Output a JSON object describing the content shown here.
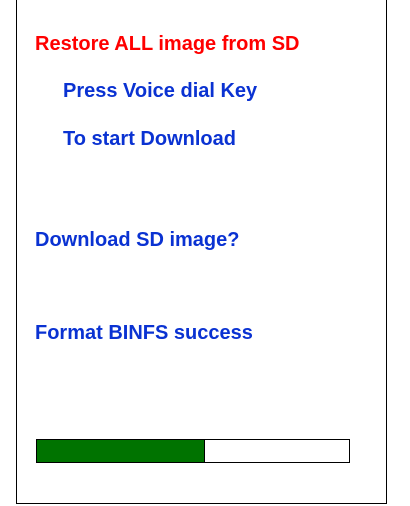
{
  "screen": {
    "title": "Restore ALL image from SD",
    "prompt_line1": "Press Voice dial Key",
    "prompt_line2": "To start Download",
    "question": "Download SD image?",
    "status": "Format BINFS success"
  },
  "progress": {
    "fraction": 0.54,
    "fill_color": "#007300",
    "track_color": "#ffffff"
  },
  "colors": {
    "title": "#ff0000",
    "text": "#0a32d2"
  }
}
